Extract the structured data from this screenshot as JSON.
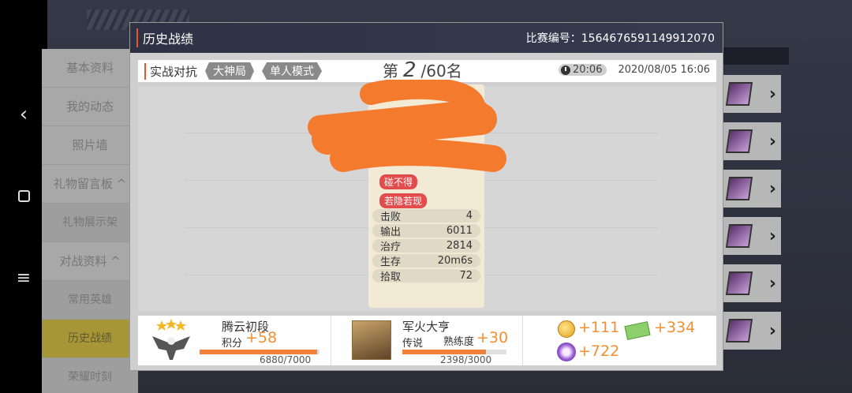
{
  "nav": {
    "back_glyph": "‹",
    "menu_glyph": "≡"
  },
  "left_menu": [
    {
      "label": "基本资料"
    },
    {
      "label": "我的动态"
    },
    {
      "label": "照片墙"
    },
    {
      "label": "礼物留言板 ^"
    },
    {
      "label": "礼物展示架"
    },
    {
      "label": "对战资料 ^"
    },
    {
      "label": "常用英雄"
    },
    {
      "label": "历史战绩"
    },
    {
      "label": "荣耀时刻"
    }
  ],
  "dialog": {
    "title": "历史战绩",
    "match_id": "比赛编号：1564676591149912070"
  },
  "info": {
    "mode": "实战对抗",
    "tag1": "大神局",
    "tag2": "单人模式",
    "rank_prefix": "第",
    "rank_num": "2",
    "rank_suffix": "/60名",
    "duration": "20:06",
    "datetime": "2020/08/05 16:06"
  },
  "card": {
    "badge1": "碰不得",
    "badge2": "若隐若现",
    "stats": [
      {
        "label": "击败",
        "value": "4"
      },
      {
        "label": "输出",
        "value": "6011"
      },
      {
        "label": "治疗",
        "value": "2814"
      },
      {
        "label": "生存",
        "value": "20m6s"
      },
      {
        "label": "拾取",
        "value": "72"
      }
    ]
  },
  "bottom": {
    "rank_name": "腾云初段",
    "points_label": "积分",
    "points_gain": "+58",
    "points_progress": "6880/7000",
    "points_fraction": 0.983,
    "hero_name": "军火大亨",
    "hero_tier": "传说",
    "proficiency_label": "熟练度",
    "proficiency_gain": "+30",
    "proficiency_progress": "2398/3000",
    "proficiency_fraction": 0.8,
    "reward_coin": "+111",
    "reward_ticket": "+334",
    "reward_orb": "+722"
  },
  "colors": {
    "accent": "#f29031",
    "header_bg": "#2d3245",
    "badge": "#e24c4c"
  }
}
